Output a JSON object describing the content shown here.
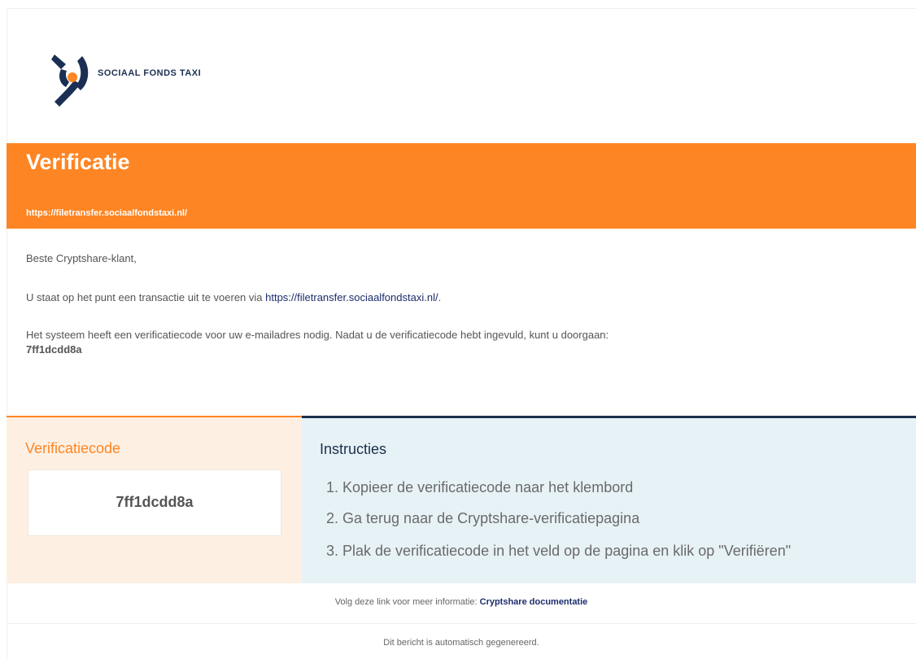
{
  "logo": {
    "text": "SOCIAAL FONDS TAXI",
    "colors": {
      "navy": "#1a2f52",
      "orange": "#fe8523"
    }
  },
  "header": {
    "title": "Verificatie",
    "url": "https://filetransfer.sociaalfondstaxi.nl/",
    "background": "#fe8523"
  },
  "message": {
    "greeting": "Beste Cryptshare-klant,",
    "line2_prefix": "U staat op het punt een transactie uit te voeren via ",
    "line2_link": "https://filetransfer.sociaalfondstaxi.nl/",
    "line2_suffix": ".",
    "line3": "Het systeem heeft een verificatiecode voor uw e-mailadres nodig. Nadat u de verificatiecode hebt ingevuld, kunt u doorgaan:",
    "code": "7ff1dcdd8a"
  },
  "code_panel": {
    "title": "Verificatiecode",
    "code": "7ff1dcdd8a"
  },
  "instructions": {
    "title": "Instructies",
    "items": [
      "1. Kopieer de verificatiecode naar het klembord",
      "2. Ga terug naar de Cryptshare-verificatiepagina",
      "3. Plak de verificatiecode in het veld op de pagina en klik op \"Verifiëren\""
    ]
  },
  "footer": {
    "more_info_prefix": "Volg deze link voor meer informatie: ",
    "more_info_link": "Cryptshare documentatie",
    "auto_message": "Dit bericht is automatisch gegenereerd."
  }
}
